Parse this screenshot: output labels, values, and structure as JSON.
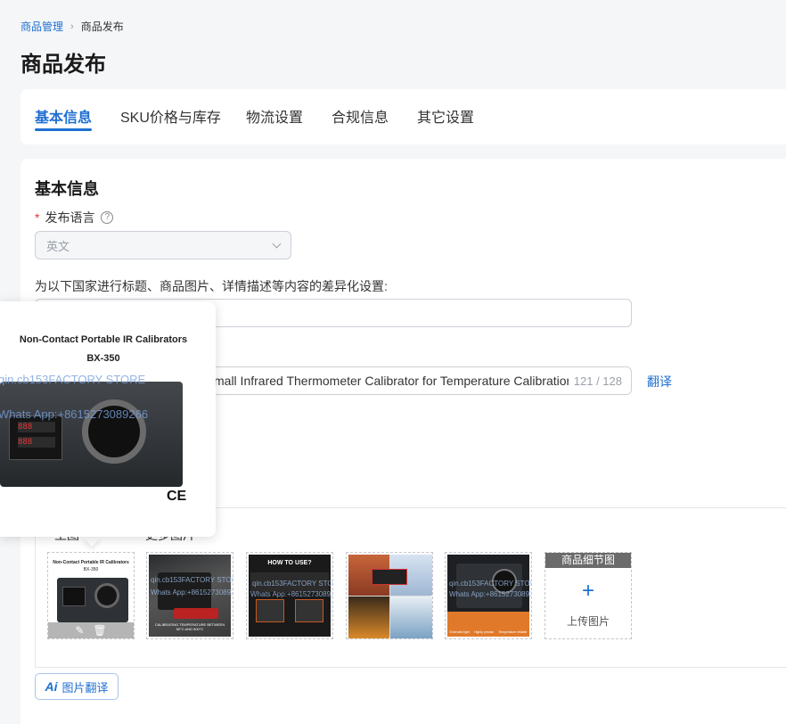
{
  "breadcrumb": {
    "parent": "商品管理",
    "current": "商品发布"
  },
  "page_title": "商品发布",
  "tabs": [
    {
      "label": "基本信息"
    },
    {
      "label": "SKU价格与库存"
    },
    {
      "label": "物流设置"
    },
    {
      "label": "合规信息"
    },
    {
      "label": "其它设置"
    }
  ],
  "basic": {
    "section_title": "基本信息",
    "lang_label": "发布语言",
    "lang_value": "英文",
    "country_label": "为以下国家进行标题、商品图片、详情描述等内容的差异化设置:",
    "title_value": "mall Infrared Thermometer Calibrator  for Temperature Calibration",
    "title_counter": "121 / 128",
    "translate": "翻译"
  },
  "images": {
    "main_label": "主图",
    "more_label": "更多图片",
    "detail_header": "商品细节图",
    "upload_label": "上传图片",
    "thumb2_caption": "CALIBRATING TEMPERATURE BETWEEN 50°C AND 500°C",
    "thumb3_header": "HOW TO USE?",
    "thumb5_labels": [
      "Extended light",
      "Highly precise",
      "Temperature reliable"
    ],
    "watermark_store": "qin.cb153FACTORY STORE",
    "watermark_app": "Whats App:+8615273089266"
  },
  "ai_translate": {
    "mark": "Ai",
    "label": "图片翻译"
  },
  "popover": {
    "title_line1": "Non-Contact Portable IR Calibrators",
    "title_line2": "BX-350",
    "watermark_store": "qin.cb153FACTORY STORE",
    "watermark_app": "Whats App:+8615273089266",
    "ce_mark": "CE"
  },
  "colors": {
    "primary": "#1f6fd1",
    "required": "#e53935"
  }
}
